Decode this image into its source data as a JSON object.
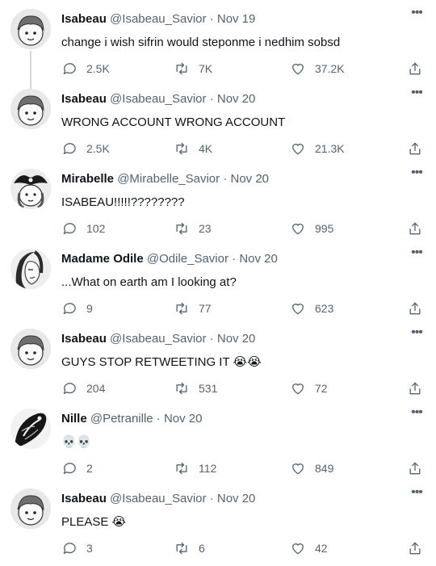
{
  "tweets": [
    {
      "name": "Isabeau",
      "handle": "@Isabeau_Savior",
      "date": "Nov 19",
      "text": "change i wish sifrin would steponme i nedhim sobsd",
      "emoji": "",
      "replies": "2.5K",
      "retweets": "7K",
      "likes": "37.2K",
      "avatar": "isabeau-avatar"
    },
    {
      "name": "Isabeau",
      "handle": "@Isabeau_Savior",
      "date": "Nov 20",
      "text": "WRONG ACCOUNT WRONG ACCOUNT",
      "emoji": "",
      "replies": "2.5K",
      "retweets": "4K",
      "likes": "21.3K",
      "avatar": "isabeau-avatar"
    },
    {
      "name": "Mirabelle",
      "handle": "@Mirabelle_Savior",
      "date": "Nov 20",
      "text": "ISABEAU!!!!!????????",
      "emoji": "",
      "replies": "102",
      "retweets": "23",
      "likes": "995",
      "avatar": "mirabelle-avatar"
    },
    {
      "name": "Madame Odile",
      "handle": "@Odile_Savior",
      "date": "Nov 20",
      "text": "...What on earth am I looking at?",
      "emoji": "",
      "replies": "9",
      "retweets": "77",
      "likes": "623",
      "avatar": "odile-avatar"
    },
    {
      "name": "Isabeau",
      "handle": "@Isabeau_Savior",
      "date": "Nov 20",
      "text": "GUYS STOP RETWEETING IT ",
      "emoji": "😭😭",
      "replies": "204",
      "retweets": "531",
      "likes": "72",
      "avatar": "isabeau-avatar"
    },
    {
      "name": "Nille",
      "handle": "@Petranille",
      "date": "Nov 20",
      "text": "",
      "emoji": "💀💀",
      "replies": "2",
      "retweets": "112",
      "likes": "849",
      "avatar": "nille-avatar"
    },
    {
      "name": "Isabeau",
      "handle": "@Isabeau_Savior",
      "date": "Nov 20",
      "text": "PLEASE ",
      "emoji": "😭",
      "replies": "3",
      "retweets": "6",
      "likes": "42",
      "avatar": "isabeau-avatar"
    }
  ],
  "separator": "·",
  "icons": {
    "more": "more-dots-icon",
    "reply": "reply-icon",
    "retweet": "retweet-icon",
    "like": "heart-icon",
    "share": "share-icon"
  },
  "colors": {
    "text": "#0f1419",
    "secondary": "#536471",
    "thread_line": "#cfd9de",
    "background": "#ffffff"
  }
}
